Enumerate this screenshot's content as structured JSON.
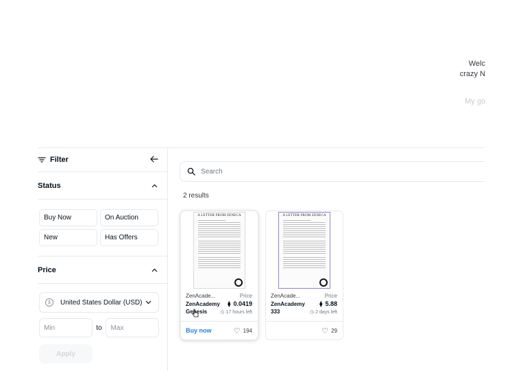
{
  "welcome": {
    "line1": "Welc",
    "line2": "crazy N",
    "line3": "My go"
  },
  "filter": {
    "title": "Filter"
  },
  "status": {
    "title": "Status",
    "chips": [
      "Buy Now",
      "On Auction",
      "New",
      "Has Offers"
    ]
  },
  "price": {
    "title": "Price",
    "currency": "United States Dollar (USD)",
    "currency_symbol": "$",
    "min_placeholder": "Min",
    "max_placeholder": "Max",
    "to": "to",
    "apply": "Apply"
  },
  "search": {
    "placeholder": "Search"
  },
  "results_text": "2 results",
  "cards": [
    {
      "doc_title": "A LETTER FROM ZENECA",
      "collection": "ZenAcade...",
      "name_line1": "ZenAcademy",
      "name_line2": "Genesis",
      "price_label": "Price",
      "price": "0.0419",
      "time_left": "17 hours left",
      "buy_label": "Buy now",
      "favorites": "194"
    },
    {
      "doc_title": "A LETTER FROM ZENECA",
      "collection": "ZenAcade...",
      "name_line1": "ZenAcademy",
      "name_line2": "333",
      "price_label": "Price",
      "price": "5.88",
      "time_left": "2 days left",
      "favorites": "29"
    }
  ],
  "colors": {
    "accent": "#2081e2",
    "border": "#e5e8eb"
  }
}
